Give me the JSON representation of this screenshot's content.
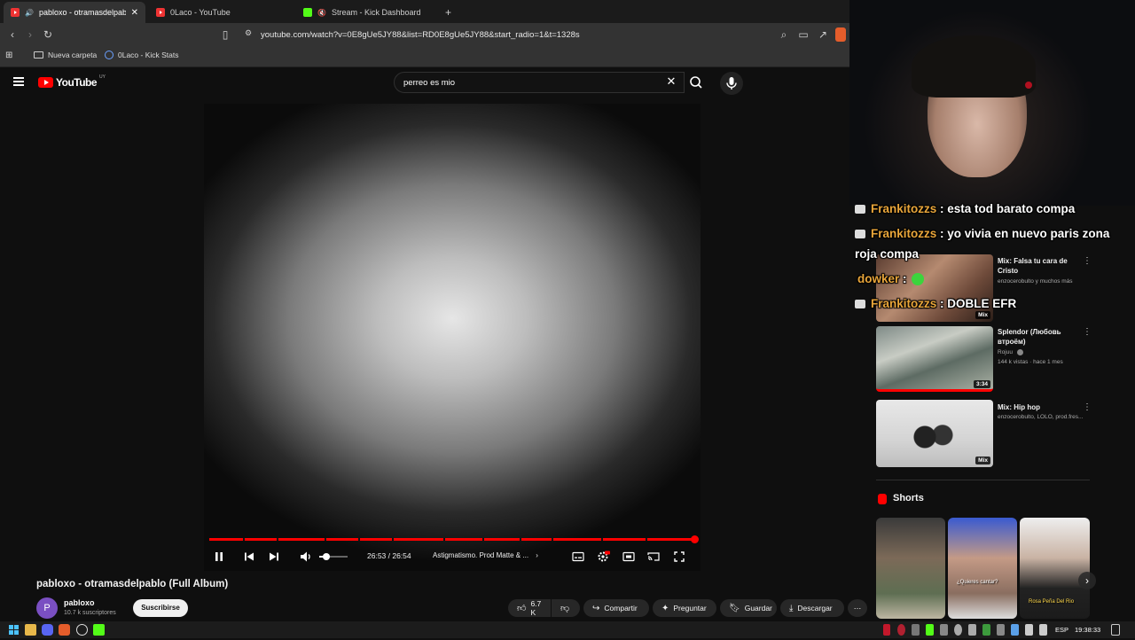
{
  "browser": {
    "tabs": [
      {
        "label": "pabloxo - otramasdelpablo (F",
        "active": true
      },
      {
        "label": "0Laco - YouTube",
        "active": false
      },
      {
        "label": "Stream - Kick Dashboard",
        "active": false
      }
    ],
    "new_tab": "+",
    "url": "youtube.com/watch?v=0E8gUe5JY88&list=RD0E8gUe5JY88&start_radio=1&t=1328s",
    "bookmarks": [
      "Nueva carpeta",
      "0Laco - Kick Stats"
    ]
  },
  "youtube": {
    "logo_text": "YouTube",
    "country": "UY",
    "search_query": "perreo es mio"
  },
  "player": {
    "progress_fraction": 0.999,
    "volume_fraction": 0.25,
    "time_display": "26:53 / 26:54",
    "chapter_label": "Astigmatismo. Prod Matte & ..."
  },
  "video": {
    "title": "pabloxo - otramasdelpablo (Full Album)",
    "channel_initial": "P",
    "channel_name": "pabloxo",
    "subscribers": "10.7 k suscriptores",
    "subscribe_label": "Suscribirse",
    "like_count": "6.7 K",
    "share_label": "Compartir",
    "ask_label": "Preguntar",
    "save_label": "Guardar",
    "download_label": "Descargar"
  },
  "sidebar": {
    "recommendations": [
      {
        "title": "Mix: Falsa tu cara de Cristo",
        "meta": "enzocerobulto y muchos más",
        "badge": "Mix"
      },
      {
        "title": "Splendor (Любовь втроём)",
        "channel": "Rojuu",
        "meta": "144 k vistas · hace 1 mes",
        "badge": "3:34"
      },
      {
        "title": "Mix: Hip hop",
        "meta": "enzocerobulto, LOLO, prod.fres...",
        "badge": "Mix"
      }
    ],
    "shorts_title": "Shorts",
    "shorts_captions": [
      "¿Quieres cantar?",
      "Rosa Peña Del Rio"
    ]
  },
  "chat": [
    {
      "user": "Frankitozzs",
      "message": " : esta tod barato compa"
    },
    {
      "user": "Frankitozzs",
      "message": " : yo vivia en nuevo paris zona roja compa"
    },
    {
      "user": "dowker",
      "message": " : "
    },
    {
      "user": "Frankitozzs",
      "message": " : DOBLE EFR"
    }
  ],
  "taskbar": {
    "language": "ESP",
    "time": "19:38:33"
  },
  "colors": {
    "youtube_red": "#ff0000",
    "kick_green": "#53fc18",
    "chat_username": "#e8a53a"
  }
}
